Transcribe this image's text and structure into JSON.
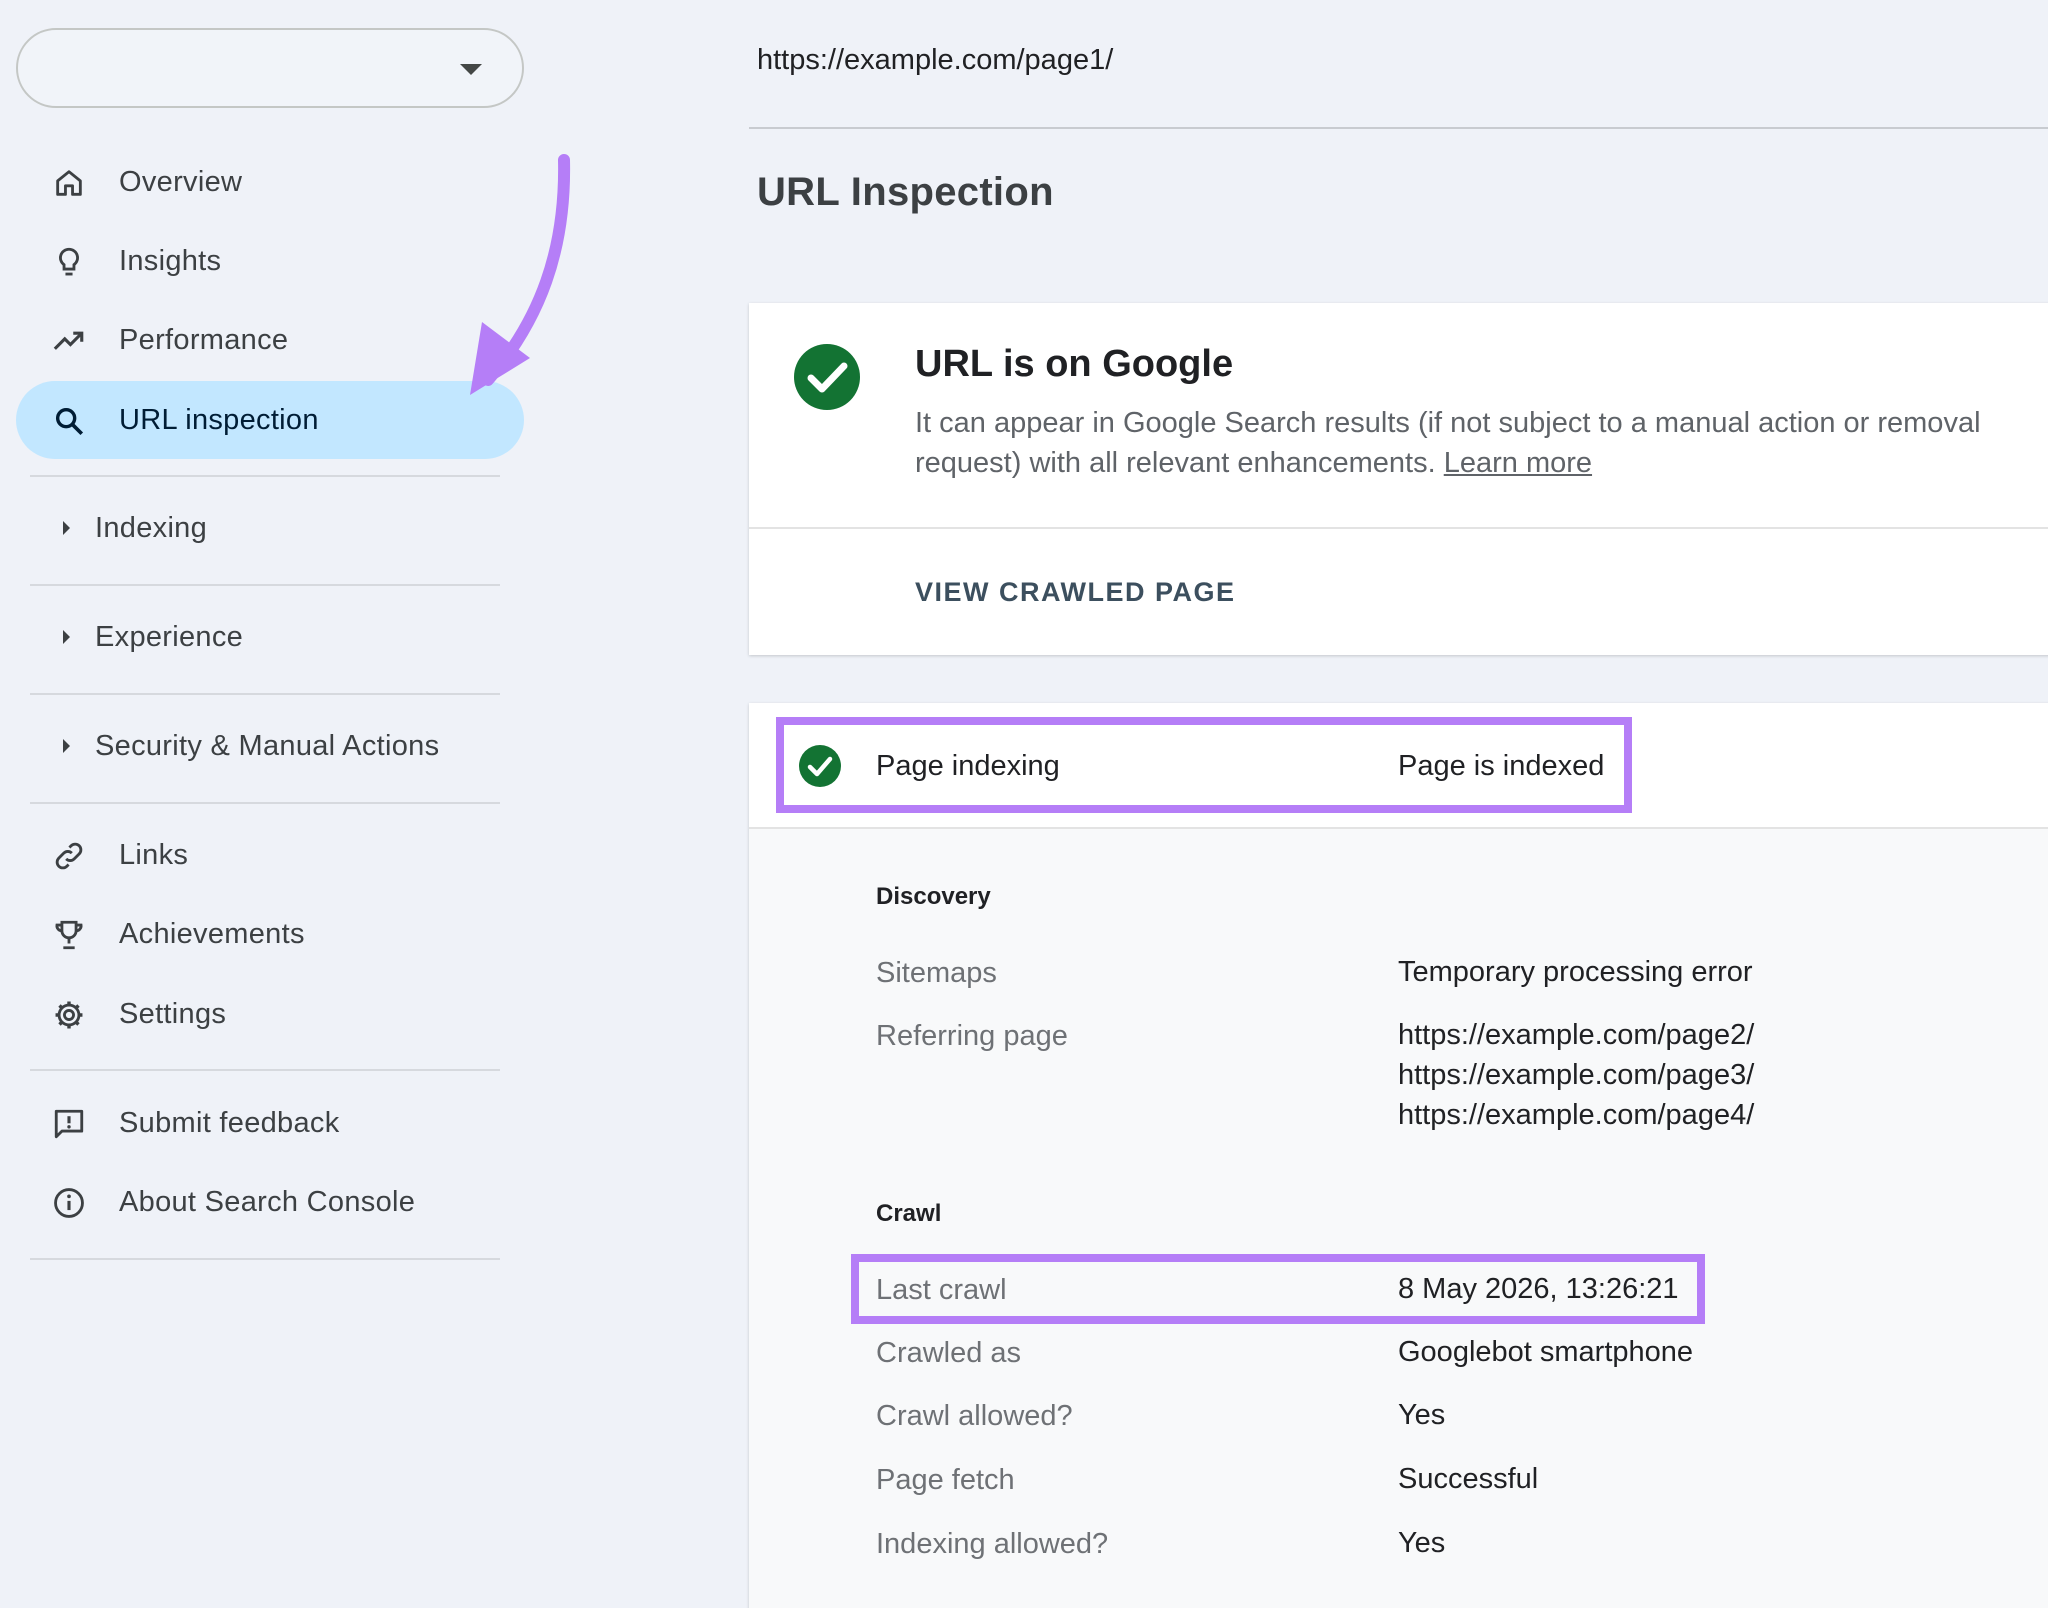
{
  "sidebar": {
    "property_selector": {
      "value": ""
    },
    "nav_top": [
      {
        "label": "Overview",
        "icon": "home-icon"
      },
      {
        "label": "Insights",
        "icon": "lightbulb-icon"
      },
      {
        "label": "Performance",
        "icon": "trending-up-icon"
      },
      {
        "label": "URL inspection",
        "icon": "search-icon",
        "active": true
      }
    ],
    "sections": [
      {
        "label": "Indexing"
      },
      {
        "label": "Experience"
      },
      {
        "label": "Security & Manual Actions"
      }
    ],
    "nav_bottom": [
      {
        "label": "Links",
        "icon": "link-icon"
      },
      {
        "label": "Achievements",
        "icon": "trophy-icon"
      },
      {
        "label": "Settings",
        "icon": "gear-icon"
      }
    ],
    "nav_footer": [
      {
        "label": "Submit feedback",
        "icon": "feedback-icon"
      },
      {
        "label": "About Search Console",
        "icon": "info-icon"
      }
    ]
  },
  "main": {
    "inspected_url": "https://example.com/page1/",
    "title": "URL Inspection",
    "status_card": {
      "headline": "URL is on Google",
      "description": "It can appear in Google Search results (if not subject to a manual action or removal request) with all relevant enhancements.",
      "learn_more": "Learn more",
      "action": "VIEW CRAWLED PAGE"
    },
    "indexing_card": {
      "label": "Page indexing",
      "value": "Page is indexed",
      "discovery": {
        "heading": "Discovery",
        "sitemaps_label": "Sitemaps",
        "sitemaps_value": "Temporary processing error",
        "referring_label": "Referring page",
        "referring_pages": [
          "https://example.com/page2/",
          "https://example.com/page3/",
          "https://example.com/page4/"
        ]
      },
      "crawl": {
        "heading": "Crawl",
        "rows": [
          {
            "label": "Last crawl",
            "value": "8 May 2026, 13:26:21"
          },
          {
            "label": "Crawled as",
            "value": "Googlebot smartphone"
          },
          {
            "label": "Crawl allowed?",
            "value": "Yes"
          },
          {
            "label": "Page fetch",
            "value": "Successful"
          },
          {
            "label": "Indexing allowed?",
            "value": "Yes"
          }
        ]
      }
    }
  },
  "colors": {
    "background": "#eff2f8",
    "active_nav": "#c2e7ff",
    "success_green": "#137333",
    "annotation_purple": "#b57ef7"
  }
}
